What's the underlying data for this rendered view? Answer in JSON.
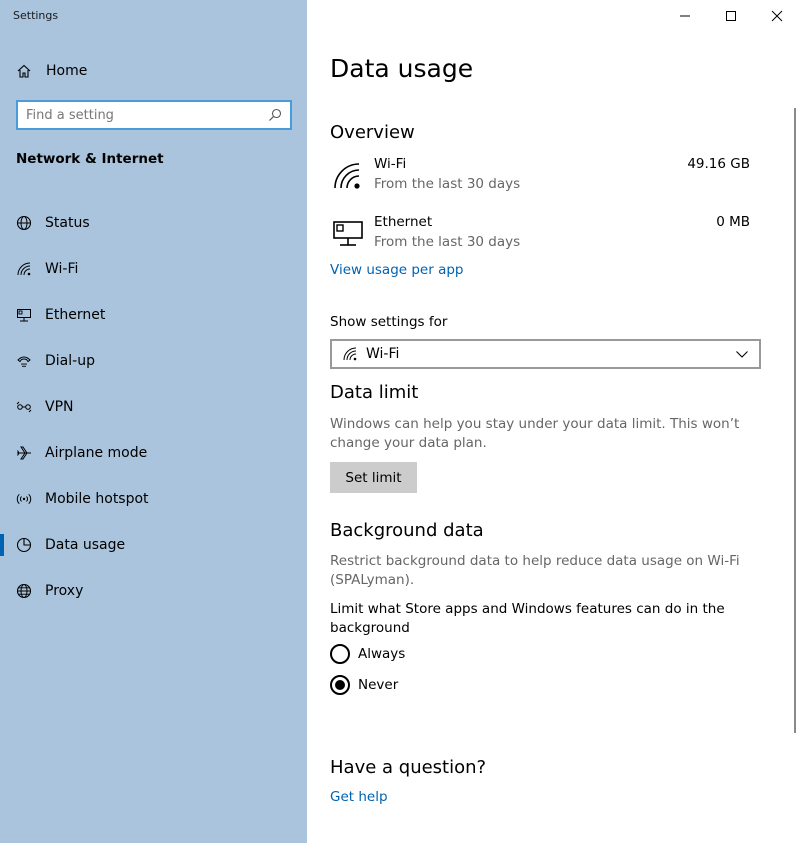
{
  "window": {
    "title": "Settings"
  },
  "sidebar": {
    "home_label": "Home",
    "search_placeholder": "Find a setting",
    "section_title": "Network & Internet",
    "items": [
      {
        "label": "Status",
        "icon": "globe-status-icon"
      },
      {
        "label": "Wi-Fi",
        "icon": "wifi-icon"
      },
      {
        "label": "Ethernet",
        "icon": "ethernet-icon"
      },
      {
        "label": "Dial-up",
        "icon": "dialup-icon"
      },
      {
        "label": "VPN",
        "icon": "vpn-icon"
      },
      {
        "label": "Airplane mode",
        "icon": "airplane-icon"
      },
      {
        "label": "Mobile hotspot",
        "icon": "hotspot-icon"
      },
      {
        "label": "Data usage",
        "icon": "data-usage-icon",
        "active": true
      },
      {
        "label": "Proxy",
        "icon": "globe-icon"
      }
    ]
  },
  "main": {
    "page_title": "Data usage",
    "overview": {
      "heading": "Overview",
      "rows": [
        {
          "name": "Wi-Fi",
          "sub": "From the last 30 days",
          "amount": "49.16 GB",
          "icon": "wifi-icon"
        },
        {
          "name": "Ethernet",
          "sub": "From the last 30 days",
          "amount": "0 MB",
          "icon": "ethernet-icon"
        }
      ],
      "link": "View usage per app"
    },
    "show_settings": {
      "label": "Show settings for",
      "selected": "Wi-Fi"
    },
    "data_limit": {
      "heading": "Data limit",
      "desc": "Windows can help you stay under your data limit. This won’t change your data plan.",
      "button": "Set limit"
    },
    "background_data": {
      "heading": "Background data",
      "desc": "Restrict background data to help reduce data usage on Wi-Fi (SPALyman).",
      "limit_label": "Limit what Store apps and Windows features can do in the background",
      "options": [
        {
          "label": "Always",
          "checked": false
        },
        {
          "label": "Never",
          "checked": true
        }
      ]
    },
    "question": {
      "heading": "Have a question?",
      "link": "Get help"
    }
  },
  "colors": {
    "sidebar_bg": "#a9c4dc",
    "accent": "#0063b1",
    "search_border": "#4a9bd9"
  }
}
